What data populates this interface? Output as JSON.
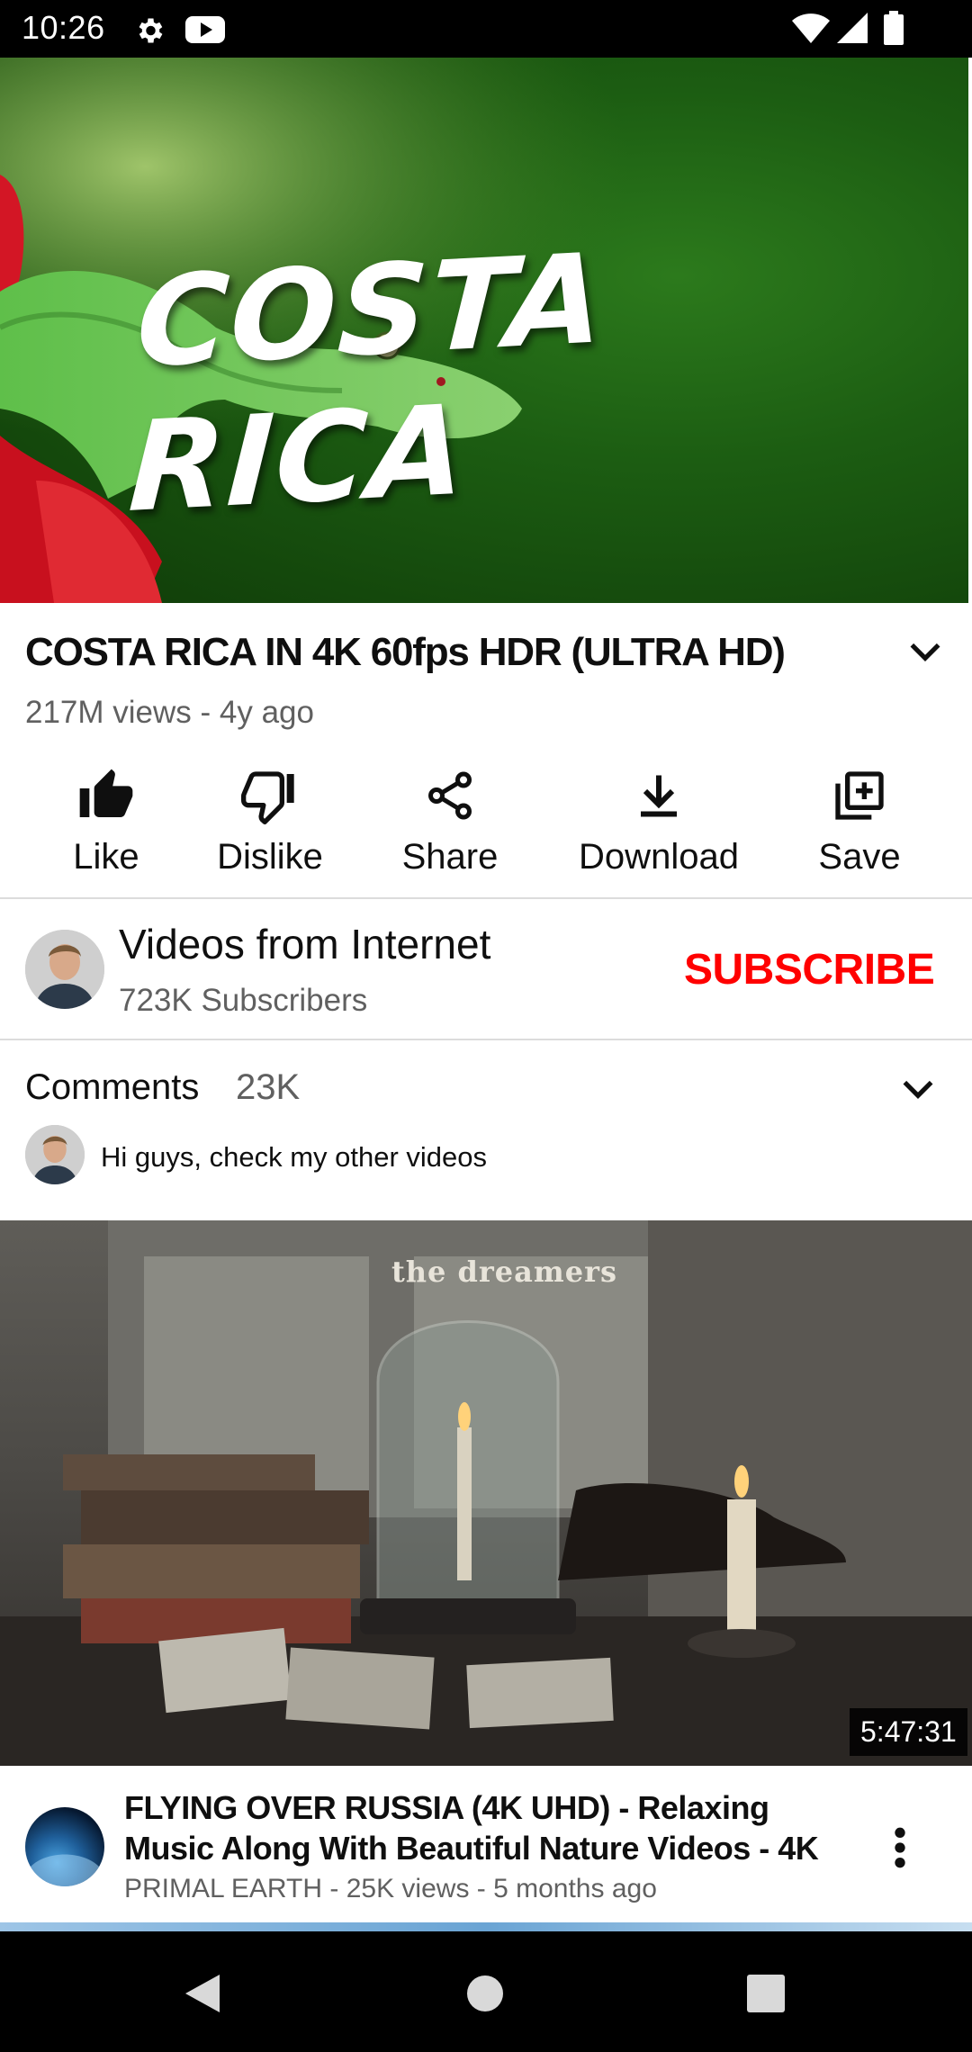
{
  "status_bar": {
    "time": "10:26",
    "icons": [
      "gear-icon",
      "youtube-icon",
      "wifi-icon",
      "signal-icon",
      "battery-icon"
    ]
  },
  "player": {
    "overlay_text": "COSTA RICA"
  },
  "video": {
    "title": "COSTA RICA IN 4K 60fps HDR (ULTRA HD)",
    "meta": "217M views - 4y ago"
  },
  "actions": [
    {
      "label": "Like",
      "icon": "thumb-up-icon"
    },
    {
      "label": "Dislike",
      "icon": "thumb-down-icon"
    },
    {
      "label": "Share",
      "icon": "share-icon"
    },
    {
      "label": "Download",
      "icon": "download-icon"
    },
    {
      "label": "Save",
      "icon": "add-to-playlist-icon"
    }
  ],
  "channel": {
    "name": "Videos from Internet",
    "subscribers": "723K Subscribers",
    "subscribe_label": "SUBSCRIBE"
  },
  "comments": {
    "label": "Comments",
    "count": "23K",
    "top_comment": "Hi guys, check my other videos"
  },
  "next_video": {
    "thumbnail_caption": "the dreamers",
    "duration": "5:47:31",
    "title": "FLYING OVER RUSSIA (4K UHD) - Relaxing Music Along With Beautiful Nature Videos - 4K",
    "meta": "PRIMAL EARTH - 25K views - 5 months ago"
  },
  "colors": {
    "accent": "#ff0000",
    "secondary_text": "#606060",
    "primary_text": "#0f0f0f"
  }
}
